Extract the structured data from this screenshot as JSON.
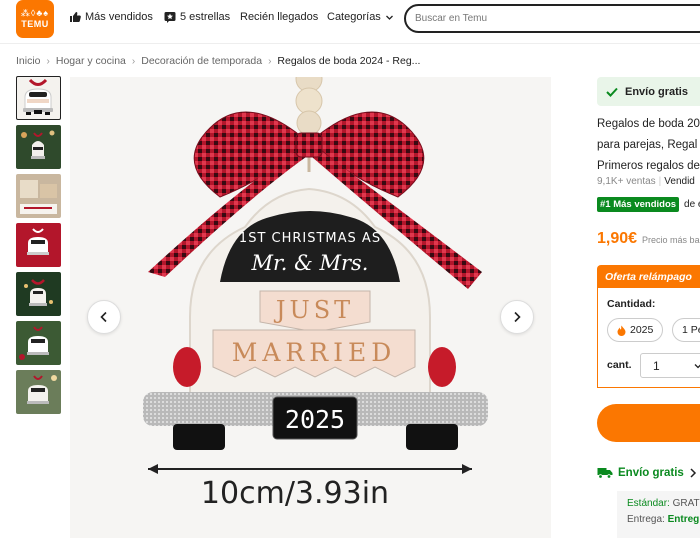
{
  "header": {
    "logo_text": "TEMU",
    "nav": [
      {
        "label": "Más vendidos",
        "icon": "thumbs-up-icon"
      },
      {
        "label": "5 estrellas",
        "icon": "star-badge-icon"
      },
      {
        "label": "Recién llegados"
      },
      {
        "label": "Categorías",
        "icon": "chevron-down-icon"
      }
    ],
    "search_placeholder": "Buscar en Temu"
  },
  "breadcrumb": [
    "Inicio",
    "Hogar y cocina",
    "Decoración de temporada",
    "Regalos de boda 2024 - Reg..."
  ],
  "gallery": {
    "thumb_count": 7,
    "active_index": 0,
    "image": {
      "top_text_line1": "1ST CHRISTMAS AS",
      "top_text_line2": "Mr. & Mrs.",
      "banner_line1": "JUST",
      "banner_line2": "MARRIED",
      "plate": "2025",
      "dimension": "10cm/3.93in"
    }
  },
  "product": {
    "shipping_badge": "Envío gratis",
    "title_lines": [
      "Regalos de boda 20",
      "para parejas, Regal",
      "Primeros regalos de"
    ],
    "sales": "9,1K+ ventas",
    "sold_by": "Vendid",
    "bestseller_badge": "#1 Más vendidos",
    "bestseller_desc": "de es",
    "price": "1,90€",
    "price_note": "Precio más ba",
    "flash_label": "Oferta relámpago",
    "quantity_label": "Cantidad:",
    "options": [
      "2025",
      "1 Pe"
    ],
    "cant_label": "cant.",
    "cant_value": "1",
    "free_shipping_link": "Envío gratis",
    "ship_standard_label": "Estándar:",
    "ship_standard_value": "GRAT",
    "ship_delivery_label": "Entrega:",
    "ship_delivery_value": "Entreg"
  },
  "colors": {
    "brand": "#fb7701",
    "green": "#0a8a1f",
    "ribbon_red": "#b3162b"
  }
}
